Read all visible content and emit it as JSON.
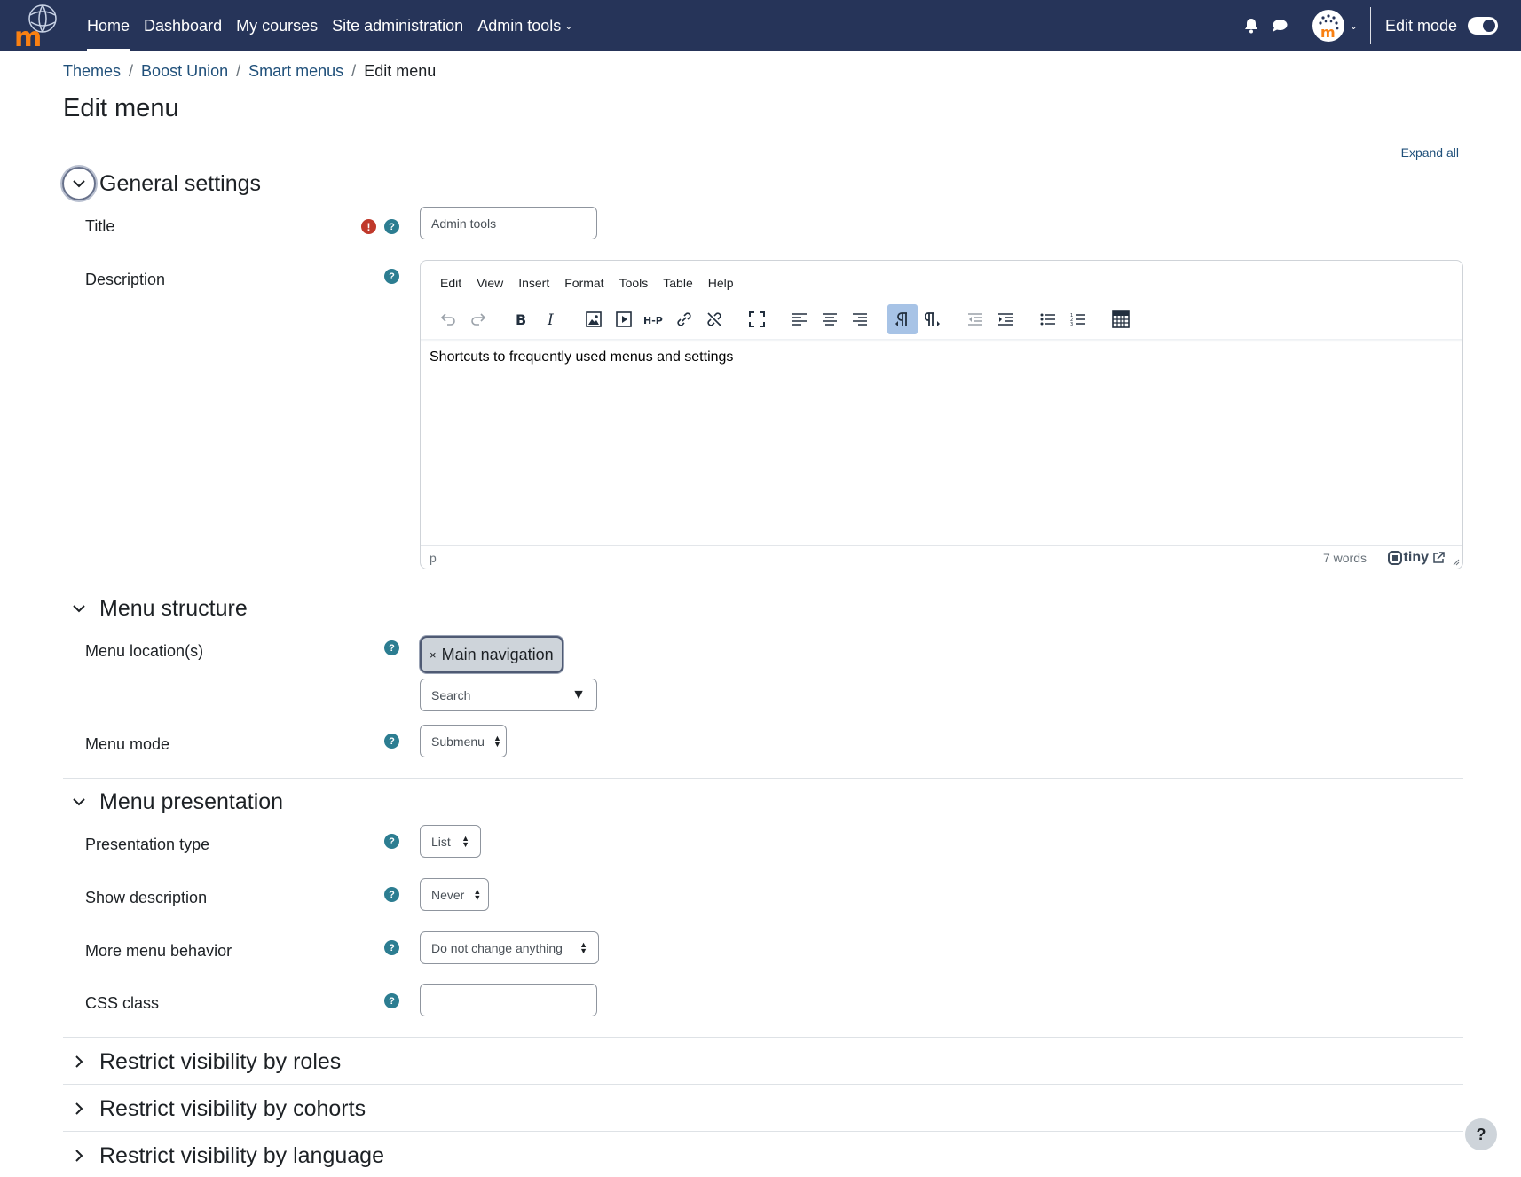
{
  "navbar": {
    "items": [
      "Home",
      "Dashboard",
      "My courses",
      "Site administration",
      "Admin tools"
    ],
    "edit_mode_label": "Edit mode"
  },
  "breadcrumb": [
    "Themes",
    "Boost Union",
    "Smart menus",
    "Edit menu"
  ],
  "page_title": "Edit menu",
  "expand_all": "Expand all",
  "sections": {
    "general": {
      "title": "General settings",
      "title_label": "Title",
      "title_value": "Admin tools",
      "description_label": "Description",
      "editor": {
        "menu": [
          "Edit",
          "View",
          "Insert",
          "Format",
          "Tools",
          "Table",
          "Help"
        ],
        "content": "Shortcuts to frequently used menus and settings",
        "status_path": "p",
        "word_count": "7 words",
        "brand": "tiny"
      }
    },
    "structure": {
      "title": "Menu structure",
      "location_label": "Menu location(s)",
      "location_tag": "Main navigation",
      "location_tag_remove": "×",
      "search_placeholder": "Search",
      "mode_label": "Menu mode",
      "mode_value": "Submenu"
    },
    "presentation": {
      "title": "Menu presentation",
      "type_label": "Presentation type",
      "type_value": "List",
      "show_desc_label": "Show description",
      "show_desc_value": "Never",
      "more_menu_label": "More menu behavior",
      "more_menu_value": "Do not change anything",
      "css_label": "CSS class",
      "css_value": ""
    },
    "roles": {
      "title": "Restrict visibility by roles"
    },
    "cohorts": {
      "title": "Restrict visibility by cohorts"
    },
    "language": {
      "title": "Restrict visibility by language"
    }
  },
  "help_button": "?",
  "colors": {
    "navbar": "#263459",
    "link": "#20507a",
    "help_icon": "#2c7d91",
    "required_icon": "#c0392b",
    "logo_orange": "#f98012"
  }
}
